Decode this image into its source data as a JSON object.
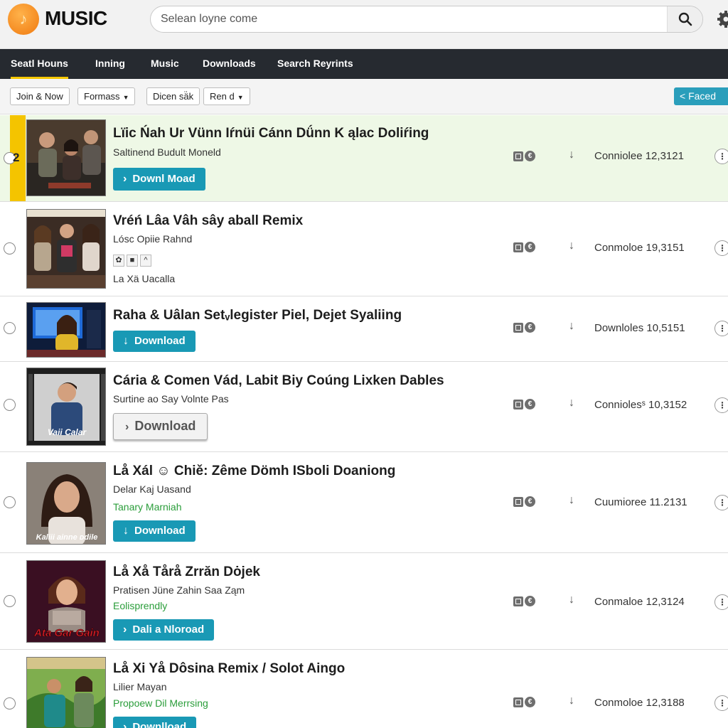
{
  "app": {
    "logo_glyph": "♪",
    "name": "MUSIC"
  },
  "search": {
    "placeholder": "Selean loyne come",
    "icon": "search-icon"
  },
  "nav": {
    "items": [
      {
        "label": "Seatl Houns",
        "active": true
      },
      {
        "label": "Inning"
      },
      {
        "label": "Music"
      },
      {
        "label": "Downloads"
      },
      {
        "label": "Search Reyrints"
      }
    ]
  },
  "toolbar": {
    "join_now": "Join & Now",
    "formats": "Formass",
    "dicen": "Dicen sä̈k",
    "rend": "Ren d",
    "faced": "Faced",
    "accent": "#2a9ebb"
  },
  "colors": {
    "download_button": "#1999b5",
    "highlight_row": "#eef8e6",
    "rank_bar": "#f4c400",
    "nav_bg": "#262a30"
  },
  "songs": [
    {
      "rank": "2",
      "title": "Lïic Ńah Ur Vünn Iŕnüi Cánn Dǘnn K ąlac Doliŕing",
      "subtitle": "Saltinend Budult Moneld",
      "button": "Downl Moad",
      "count": "Conniolee 12,3121"
    },
    {
      "title": "Vréń Lâa Vâh sây aball Remix",
      "subtitle": "Lósc Opiie Rahnd",
      "extra": "La Xä Uacalla",
      "mini_icons": [
        "✿",
        "■",
        "^"
      ],
      "count": "Conmoloe 19,3151"
    },
    {
      "title": "Raha & Uâlan Setᵥlegister Piel, Dejet Syaliing",
      "button": "Download",
      "count": "Downloles 10,5151"
    },
    {
      "title": "Cária & Comen Vád, Labit Biy Coúng Lixken Dables",
      "subtitle": "Surtine ao Say Volnte Pas",
      "button": "Download",
      "thumb_text": "Vaii Calar",
      "count": "Conniolesˢ 10,3152"
    },
    {
      "title": "Lå Xál ☺ Chiě: Zême Dömh ISboli Doaniong",
      "subtitle": "Delar Kaj Uasand",
      "extra": "Tanary Marniah",
      "button": "Download",
      "thumb_text": "Kaliii ainne ᴅdile",
      "count": "Cuumioree 11.2131"
    },
    {
      "title": "Lå Xå Tårå Zrrăn Dȯjek",
      "subtitle": "Pratisen Jüne Zahin Saa Ząm",
      "extra": "Eolisprendly",
      "button": "Dali a Nloroad",
      "thumb_text": "Ata Gar Gain",
      "count": "Conmaloe 12,3124"
    },
    {
      "title": "Lå Xi Yå Dôsina Remix / Solot Aingo",
      "subtitle": "Lilier Mayan",
      "extra": "Propoew Dil Merrsing",
      "button": "Downlload",
      "count": "Conmoloe 12,3188"
    }
  ]
}
